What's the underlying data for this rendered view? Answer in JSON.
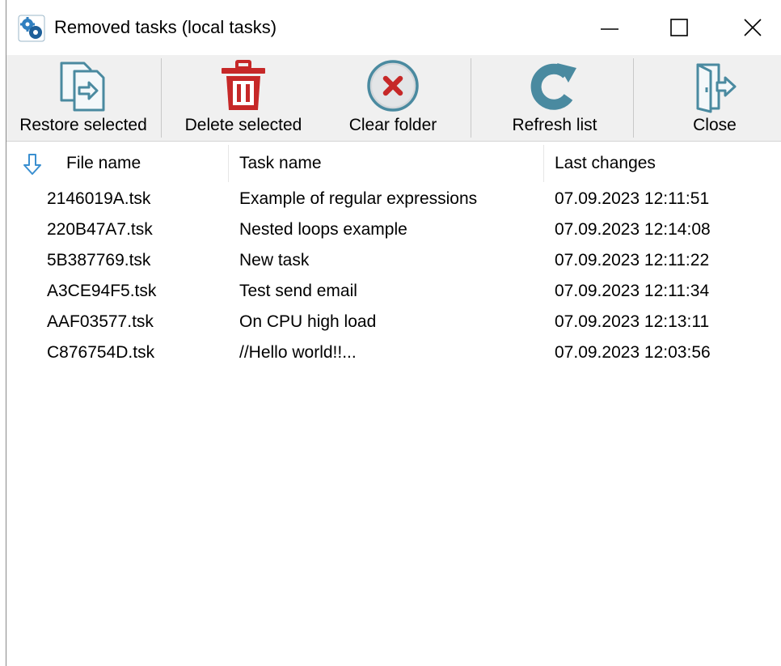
{
  "window": {
    "title": "Removed tasks (local tasks)",
    "controls": [
      "minimize",
      "maximize",
      "close"
    ]
  },
  "toolbar": {
    "restore_label": "Restore selected",
    "delete_label": "Delete selected",
    "clear_label": "Clear folder",
    "refresh_label": "Refresh list",
    "close_label": "Close"
  },
  "colors": {
    "toolbar_bg": "#f0f0f0",
    "icon_teal": "#4a8aa0",
    "icon_red": "#c62828",
    "sort_arrow": "#3a8fd0"
  },
  "table": {
    "columns": [
      "File name",
      "Task name",
      "Last changes"
    ],
    "sort": {
      "column": "File name",
      "direction": "descending"
    },
    "rows": [
      {
        "file": "2146019A.tsk",
        "task": "Example of regular expressions",
        "changed": "07.09.2023 12:11:51"
      },
      {
        "file": "220B47A7.tsk",
        "task": "Nested loops example",
        "changed": "07.09.2023 12:14:08"
      },
      {
        "file": "5B387769.tsk",
        "task": "New task",
        "changed": "07.09.2023 12:11:22"
      },
      {
        "file": "A3CE94F5.tsk",
        "task": "Test send email",
        "changed": "07.09.2023 12:11:34"
      },
      {
        "file": "AAF03577.tsk",
        "task": "On CPU high load",
        "changed": "07.09.2023 12:13:11"
      },
      {
        "file": "C876754D.tsk",
        "task": "//Hello world!!...",
        "changed": "07.09.2023 12:03:56"
      }
    ]
  }
}
